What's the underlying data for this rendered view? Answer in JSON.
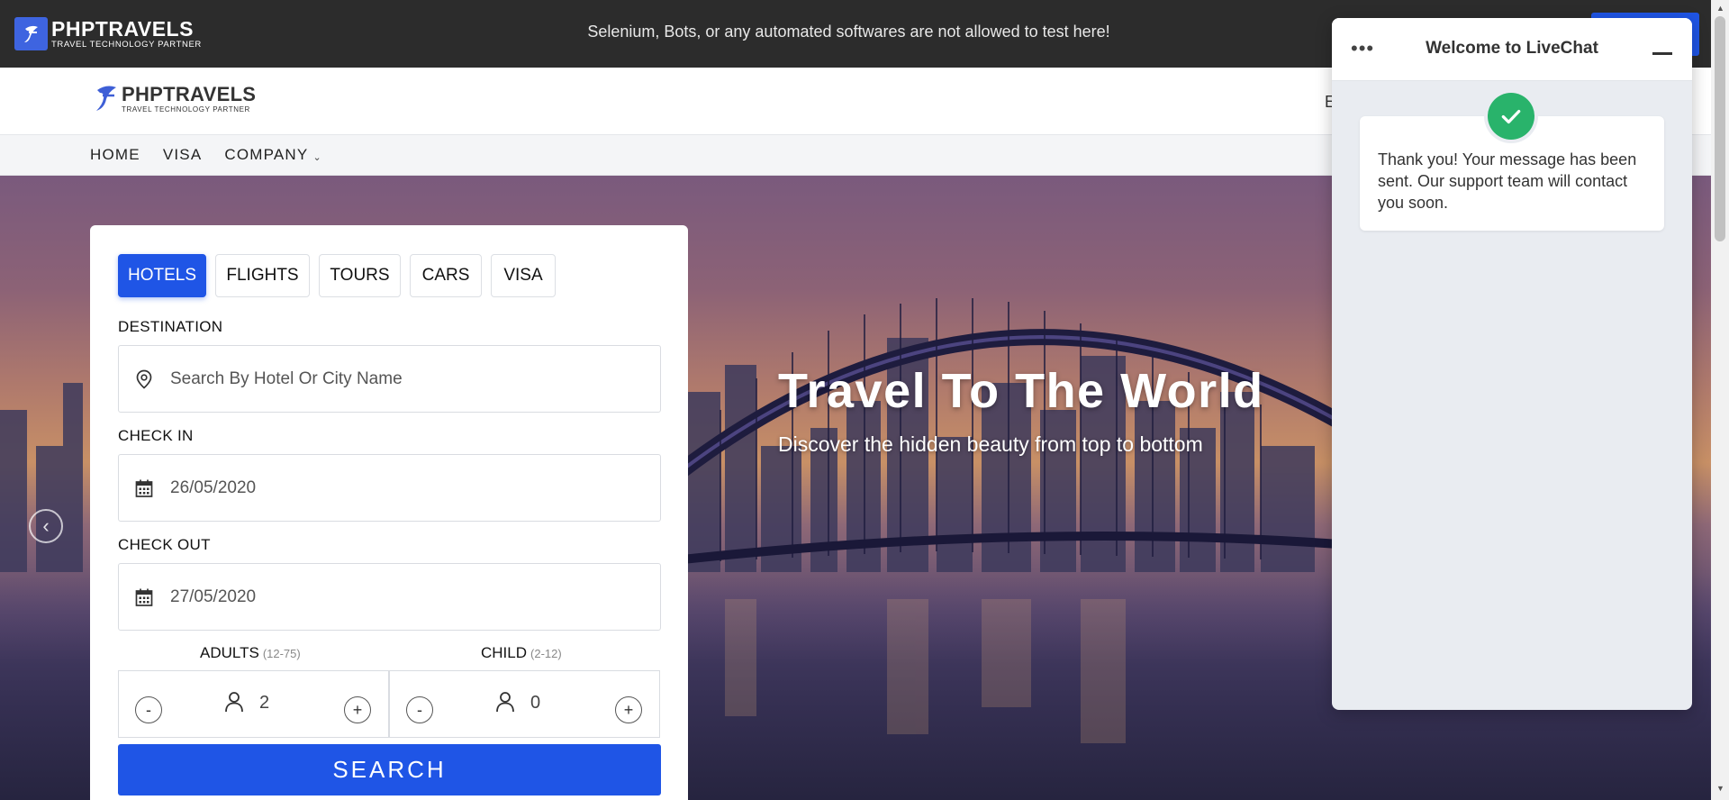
{
  "topbar": {
    "brand": "PHPTRAVELS",
    "tagline": "TRAVEL TECHNOLOGY PARTNER",
    "notice": "Selenium, Bots, or any automated softwares are not allowed to test here!"
  },
  "header": {
    "brand": "PHPTRAVELS",
    "tagline": "TRAVEL TECHNOLOGY PARTNER",
    "partial_text": "E"
  },
  "nav": {
    "items": [
      {
        "label": "HOME"
      },
      {
        "label": "VISA"
      },
      {
        "label": "COMPANY"
      }
    ]
  },
  "hero": {
    "title": "Travel To The World",
    "subtitle": "Discover the hidden beauty from top to bottom"
  },
  "search": {
    "tabs": [
      {
        "label": "HOTELS",
        "active": true
      },
      {
        "label": "FLIGHTS",
        "active": false
      },
      {
        "label": "TOURS",
        "active": false
      },
      {
        "label": "CARS",
        "active": false
      },
      {
        "label": "VISA",
        "active": false
      }
    ],
    "destination_label": "DESTINATION",
    "destination_placeholder": "Search By Hotel Or City Name",
    "checkin_label": "CHECK IN",
    "checkin_value": "26/05/2020",
    "checkout_label": "CHECK OUT",
    "checkout_value": "27/05/2020",
    "adults_label": "ADULTS",
    "adults_range": "(12-75)",
    "adults_value": "2",
    "child_label": "CHILD",
    "child_range": "(2-12)",
    "child_value": "0",
    "minus": "-",
    "plus": "+",
    "submit": "SEARCH"
  },
  "livechat": {
    "title": "Welcome to LiveChat",
    "message": "Thank you! Your message has been sent. Our support team will contact you soon."
  },
  "colors": {
    "accent": "#1f55e6",
    "topbar_bg": "#2c2c2c",
    "success": "#29b36b",
    "chat_bg": "#e9ecf1"
  },
  "icons": [
    "logo-icon",
    "location-pin-icon",
    "calendar-icon",
    "person-icon",
    "check-icon",
    "more-dots-icon",
    "minimize-icon",
    "chevron-left-icon",
    "chevron-down-icon"
  ]
}
